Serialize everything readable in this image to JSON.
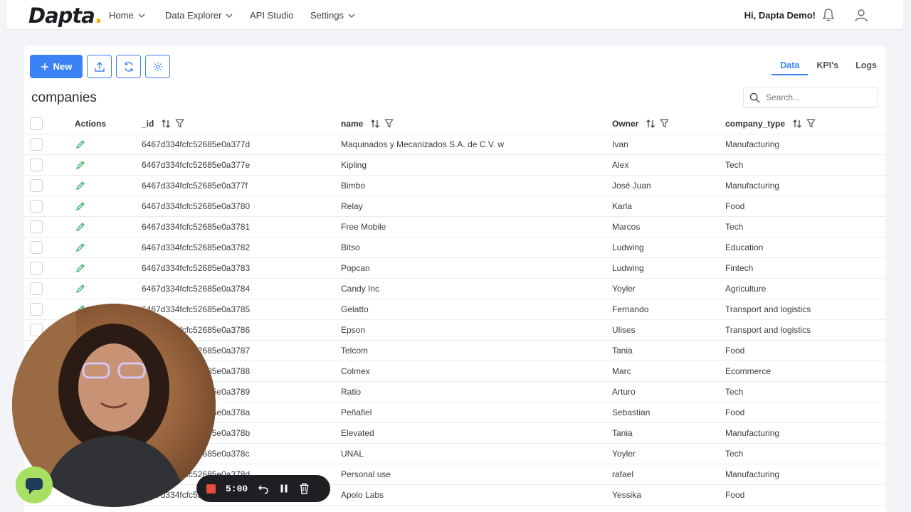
{
  "app": {
    "logo": "Dapta",
    "greeting": "Hi, Dapta Demo!"
  },
  "nav": [
    {
      "label": "Home",
      "has_menu": true
    },
    {
      "label": "Data Explorer",
      "has_menu": true
    },
    {
      "label": "API Studio",
      "has_menu": false
    },
    {
      "label": "Settings",
      "has_menu": true
    }
  ],
  "toolbar": {
    "new_label": "New"
  },
  "tabs": [
    {
      "label": "Data",
      "active": true
    },
    {
      "label": "KPI's",
      "active": false
    },
    {
      "label": "Logs",
      "active": false
    }
  ],
  "page": {
    "title": "companies"
  },
  "search": {
    "placeholder": "Search..."
  },
  "table": {
    "headers": {
      "actions": "Actions",
      "id": "_id",
      "name": "name",
      "owner": "Owner",
      "type": "company_type"
    },
    "rows": [
      {
        "id": "6467d334fcfc52685e0a377d",
        "name": "Maquinados y Mecanizados S.A. de C.V. w",
        "owner": "Ivan",
        "type": "Manufacturing"
      },
      {
        "id": "6467d334fcfc52685e0a377e",
        "name": "Kipling",
        "owner": "Alex",
        "type": "Tech"
      },
      {
        "id": "6467d334fcfc52685e0a377f",
        "name": "Bimbo",
        "owner": "José Juan",
        "type": "Manufacturing"
      },
      {
        "id": "6467d334fcfc52685e0a3780",
        "name": "Relay",
        "owner": "Karla",
        "type": "Food"
      },
      {
        "id": "6467d334fcfc52685e0a3781",
        "name": "Free Mobile",
        "owner": "Marcos",
        "type": "Tech"
      },
      {
        "id": "6467d334fcfc52685e0a3782",
        "name": "Bitso",
        "owner": "Ludwing",
        "type": "Education"
      },
      {
        "id": "6467d334fcfc52685e0a3783",
        "name": "Popcan",
        "owner": "Ludwing",
        "type": "Fintech"
      },
      {
        "id": "6467d334fcfc52685e0a3784",
        "name": "Candy Inc",
        "owner": "Yoyler",
        "type": "Agriculture"
      },
      {
        "id": "6467d334fcfc52685e0a3785",
        "name": "Gelatto",
        "owner": "Fernando",
        "type": "Transport and logistics"
      },
      {
        "id": "6467d334fcfc52685e0a3786",
        "name": "Epson",
        "owner": "Ulises",
        "type": "Transport and logistics"
      },
      {
        "id": "6467d334fcfc52685e0a3787",
        "name": "Telcom",
        "owner": "Tania",
        "type": "Food"
      },
      {
        "id": "6467d334fcfc52685e0a3788",
        "name": "Colmex",
        "owner": "Marc",
        "type": "Ecommerce"
      },
      {
        "id": "6467d334fcfc52685e0a3789",
        "name": "Ratio",
        "owner": "Arturo",
        "type": "Tech"
      },
      {
        "id": "6467d334fcfc52685e0a378a",
        "name": "Peñafiel",
        "owner": "Sebastian",
        "type": "Food"
      },
      {
        "id": "6467d334fcfc52685e0a378b",
        "name": "Elevated",
        "owner": "Tania",
        "type": "Manufacturing"
      },
      {
        "id": "6467d334fcfc52685e0a378c",
        "name": "UNAL",
        "owner": "Yoyler",
        "type": "Tech"
      },
      {
        "id": "6467d334fcfc52685e0a378d",
        "name": "Personal use",
        "owner": "rafael",
        "type": "Manufacturing"
      },
      {
        "id": "6467d334fcfc52685e0a378e",
        "name": "Apolo Labs",
        "owner": "Yessika",
        "type": "Food"
      }
    ]
  },
  "recorder": {
    "time": "5:00"
  },
  "colors": {
    "accent": "#3b82f6",
    "edit_icon": "#34b36a",
    "record": "#e74c3c"
  }
}
